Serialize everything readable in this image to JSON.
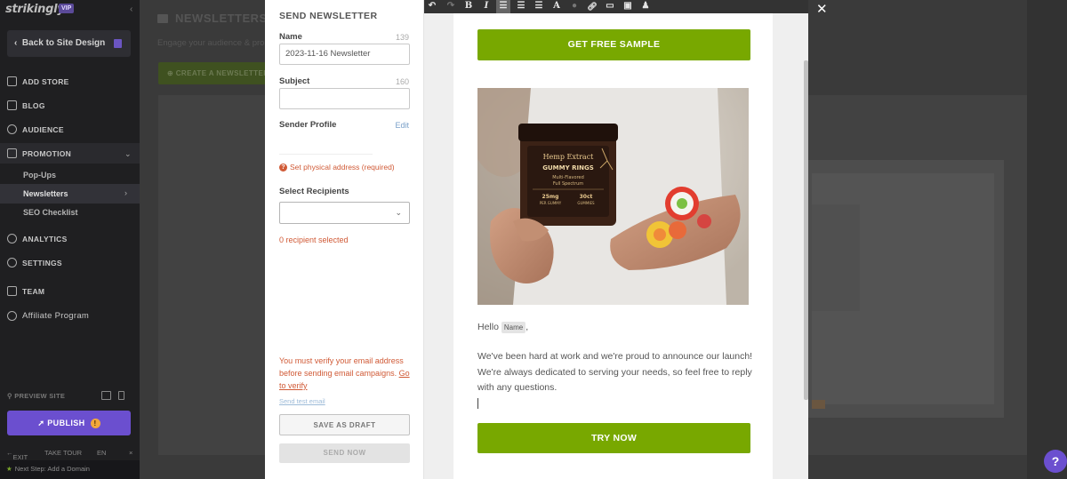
{
  "sidebar": {
    "logo": "strikingly",
    "vip": "VIP",
    "back": "Back to Site Design",
    "nav": {
      "add_store": "ADD STORE",
      "blog": "BLOG",
      "audience": "AUDIENCE",
      "promotion": "PROMOTION",
      "analytics": "ANALYTICS",
      "settings": "SETTINGS",
      "team": "TEAM",
      "affiliate": "Affiliate Program"
    },
    "promotion_sub": [
      "Pop-Ups",
      "Newsletters",
      "SEO Checklist"
    ],
    "preview_site": "PREVIEW SITE",
    "publish": "PUBLISH",
    "bottom": {
      "exit": "EXIT",
      "tour": "TAKE TOUR",
      "lang": "EN"
    },
    "next_step": "Next Step: Add a Domain"
  },
  "content": {
    "title": "NEWSLETTERS",
    "subtitle": "Engage your audience & pro",
    "create_button": "CREATE A NEWSLETTER"
  },
  "form": {
    "title": "SEND NEWSLETTER",
    "name_label": "Name",
    "name_counter": "139",
    "name_value": "2023-11-16 Newsletter",
    "subject_label": "Subject",
    "subject_counter": "160",
    "subject_value": "",
    "sender_label": "Sender Profile",
    "sender_edit": "Edit",
    "address_warning": "Set physical address (required)",
    "recipients_label": "Select Recipients",
    "recipients_status": "0 recipient selected",
    "verify_text": "You must verify your email address before sending email campaigns.",
    "verify_link": "Go to verify",
    "test_email": "Send test email",
    "save_draft": "SAVE AS DRAFT",
    "send_now": "SEND NOW"
  },
  "toolbar": {
    "undo": "↶",
    "redo": "↷",
    "bold": "B",
    "italic": "I",
    "font": "A"
  },
  "email": {
    "cta_top": "GET FREE SAMPLE",
    "product": {
      "brand": "Hemp Extract",
      "name": "GUMMY RINGS",
      "flavor": "Multi-Flavored",
      "spectrum": "Full Spectrum",
      "dose": "25mg",
      "dose_unit": "PER GUMMY",
      "count": "30ct",
      "count_unit": "GUMMIES"
    },
    "greeting": "Hello",
    "name_tag": "Name",
    "greeting_punct": ",",
    "body": "We've been hard at work and we're proud to announce our launch! We're always dedicated to serving your needs, so feel free to reply with any questions.",
    "cta_bottom": "TRY NOW"
  },
  "colors": {
    "accent_green": "#78a800",
    "brand_purple": "#6b4fcf",
    "warning_red": "#d05a36"
  }
}
